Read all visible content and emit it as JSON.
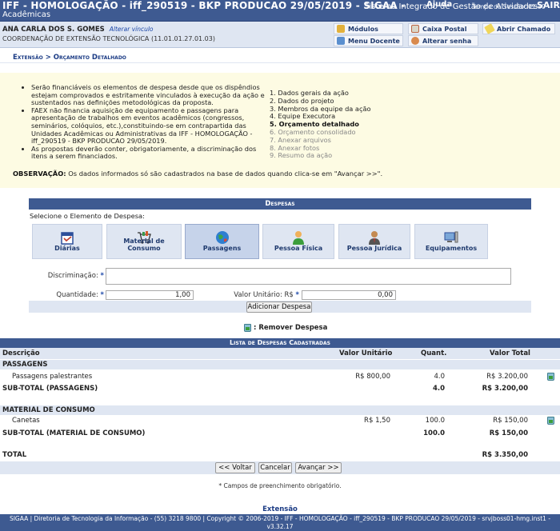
{
  "header": {
    "title": "IFF - HOMOLOGAÇÃO - iff_290519 - BKP PRODUCAO 29/05/2019 - SIGAA -",
    "subtitle": "Acadêmicas",
    "overlay": "Sistema Integrado de Gestão de Atividades",
    "ajuda": "Ajuda",
    "tempo": "Tempo de Sessão: 01:30",
    "sair": "SAIR"
  },
  "user": {
    "name": "ANA CARLA DOS S. GOMES",
    "alterar_vinculo": "Alterar vínculo",
    "coordenacao": "COORDENAÇÃO DE EXTENSÃO TECNOLÓGICA (11.01.01.27.01.03)"
  },
  "user_menu": {
    "modulos": "Módulos",
    "caixa_postal": "Caixa Postal",
    "abrir_chamado": "Abrir Chamado",
    "menu_docente": "Menu Docente",
    "alterar_senha": "Alterar senha"
  },
  "breadcrumb": {
    "part1": "Extensão",
    "sep": ">",
    "part2": "Orçamento Detalhado"
  },
  "info": {
    "bullets": [
      "Serão financiáveis os elementos de despesa desde que os dispêndios estejam comprovados e estritamente vinculados à execução da ação e sustentados nas definições metodológicas da proposta.",
      "FAEX não financia aquisição de equipamento e passagens para apresentação de trabalhos em eventos acadêmicos (congressos, seminários, colóquios, etc.),constituindo-se em contrapartida das Unidades Acadêmicas ou Administrativas da IFF - HOMOLOGAÇÃO - iff_290519 - BKP PRODUCAO 29/05/2019.",
      "As propostas deverão conter, obrigatoriamente, a discriminação dos itens a serem financiados."
    ],
    "steps": [
      "1. Dados gerais da ação",
      "2. Dados do projeto",
      "3. Membros da equipe da ação",
      "4. Equipe Executora",
      "5. Orçamento detalhado",
      "6. Orçamento consolidado",
      "7. Anexar arquivos",
      "8. Anexar fotos",
      "9. Resumo da ação"
    ],
    "obs_label": "OBSERVAÇÃO:",
    "obs_text": "Os dados informados só são cadastrados na base de dados quando clica-se em \"Avançar >>\"."
  },
  "despesas": {
    "title": "Despesas",
    "select_label": "Selecione o Elemento de Despesa:",
    "tabs": [
      "Diárias",
      "Material de Consumo",
      "Passagens",
      "Pessoa Física",
      "Pessoa Jurídica",
      "Equipamentos"
    ],
    "active_tab": "Passagens",
    "discriminacao_label": "Discriminação:",
    "quantidade_label": "Quantidade:",
    "quantidade_value": "1,00",
    "valor_unitario_label": "Valor Unitário: R$",
    "valor_unitario_value": "0,00",
    "adicionar": "Adicionar Despesa",
    "required_mark": "*"
  },
  "remover_label": ": Remover Despesa",
  "lista": {
    "title": "Lista de Despesas Cadastradas",
    "columns": {
      "descricao": "Descrição",
      "valor_unitario": "Valor Unitário",
      "quant": "Quant.",
      "valor_total": "Valor Total"
    },
    "groups": [
      {
        "name": "PASSAGENS",
        "item": {
          "desc": "Passagens palestrantes",
          "valor_unitario": "R$ 800,00",
          "quant": "4.0",
          "valor_total": "R$ 3.200,00"
        },
        "subtotal": {
          "label": "SUB-TOTAL (PASSAGENS)",
          "quant": "4.0",
          "valor_total": "R$ 3.200,00"
        }
      },
      {
        "name": "MATERIAL DE CONSUMO",
        "item": {
          "desc": "Canetas",
          "valor_unitario": "R$ 1,50",
          "quant": "100.0",
          "valor_total": "R$ 150,00"
        },
        "subtotal": {
          "label": "SUB-TOTAL (MATERIAL DE CONSUMO)",
          "quant": "100.0",
          "valor_total": "R$ 150,00"
        }
      }
    ],
    "total_label": "TOTAL",
    "total_value": "R$ 3.350,00"
  },
  "nav": {
    "voltar": "<< Voltar",
    "cancelar": "Cancelar",
    "avancar": "Avançar >>"
  },
  "required_note": "* Campos de preenchimento obrigatório.",
  "extensao_link": "Extensão",
  "footer": "SIGAA | Diretoria de Tecnologia da Informação - (55) 3218 9800 | Copyright © 2006-2019 - IFF - HOMOLOGAÇÃO - iff_290519 - BKP PRODUCAO 29/05/2019 - srvjboss01-hmg.inst1 - v3.32.17",
  "colors": {
    "brand": "#3e5a91",
    "light": "#dfe6f2",
    "info_bg": "#fdfbe3",
    "link": "#1c3c85"
  }
}
